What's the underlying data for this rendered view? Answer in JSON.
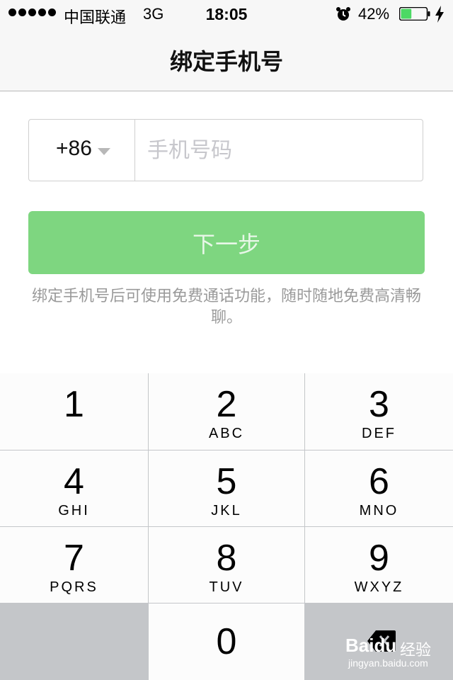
{
  "status_bar": {
    "carrier": "中国联通",
    "network": "3G",
    "time": "18:05",
    "battery_percent": "42%",
    "battery_level": 0.42,
    "signal_dots": 5
  },
  "nav": {
    "title": "绑定手机号"
  },
  "phone": {
    "country_code": "+86",
    "placeholder": "手机号码",
    "value": ""
  },
  "next_button": {
    "label": "下一步"
  },
  "hint_text": "绑定手机号后可使用免费通话功能，随时随地免费高清畅聊。",
  "keypad": {
    "keys": [
      {
        "num": "1",
        "letters": ""
      },
      {
        "num": "2",
        "letters": "ABC"
      },
      {
        "num": "3",
        "letters": "DEF"
      },
      {
        "num": "4",
        "letters": "GHI"
      },
      {
        "num": "5",
        "letters": "JKL"
      },
      {
        "num": "6",
        "letters": "MNO"
      },
      {
        "num": "7",
        "letters": "PQRS"
      },
      {
        "num": "8",
        "letters": "TUV"
      },
      {
        "num": "9",
        "letters": "WXYZ"
      },
      {
        "num": "0",
        "letters": ""
      }
    ]
  },
  "watermark": {
    "logo": "Baidu",
    "label": "经验",
    "url": "jingyan.baidu.com"
  },
  "colors": {
    "accent": "#7ed680",
    "keypad_bg": "#c4c6c9",
    "battery": "#4cd964"
  }
}
